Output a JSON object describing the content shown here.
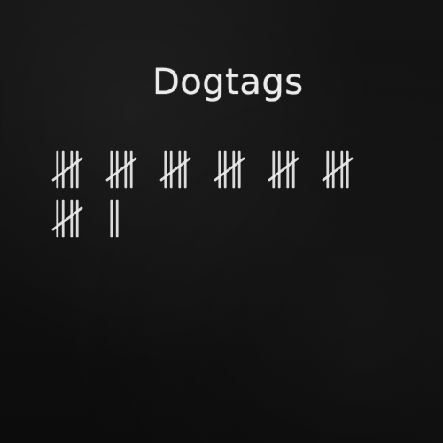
{
  "board": {
    "title": "Dogtags",
    "tally_count": 37,
    "chalk_color": "#ececec",
    "board_color": "#111111"
  }
}
